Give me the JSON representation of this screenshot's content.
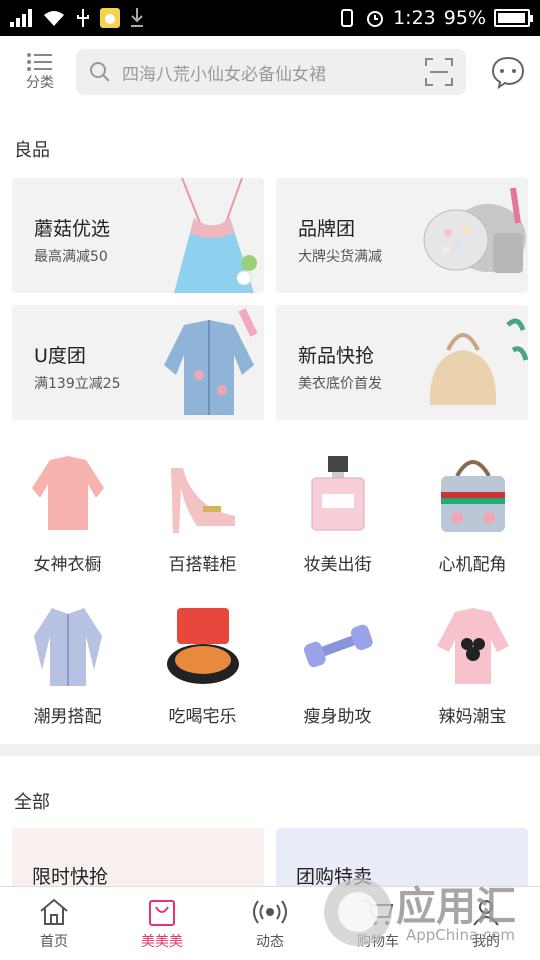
{
  "status_bar": {
    "time": "1:23",
    "battery": "95%",
    "battery_level": 0.95
  },
  "header": {
    "category_label": "分类",
    "search_placeholder": "四海八荒小仙女必备仙女裙"
  },
  "section_good": {
    "title": "良品"
  },
  "promo_cards": [
    {
      "title": "蘑菇优选",
      "subtitle": "最高满减50",
      "icon": "lace-dress-icon"
    },
    {
      "title": "品牌团",
      "subtitle": "大牌尖货满减",
      "icon": "makeup-pearls-icon"
    },
    {
      "title": "U度团",
      "subtitle": "满139立减25",
      "icon": "denim-jacket-icon"
    },
    {
      "title": "新品快抢",
      "subtitle": "美衣底价首发",
      "icon": "handbag-icon"
    }
  ],
  "categories": [
    {
      "label": "女神衣橱",
      "icon": "pink-sweater-icon"
    },
    {
      "label": "百搭鞋柜",
      "icon": "heel-shoe-icon"
    },
    {
      "label": "妆美出街",
      "icon": "perfume-icon"
    },
    {
      "label": "心机配角",
      "icon": "bag-icon"
    },
    {
      "label": "潮男搭配",
      "icon": "shirt-icon"
    },
    {
      "label": "吃喝宅乐",
      "icon": "snack-icon"
    },
    {
      "label": "瘦身助攻",
      "icon": "dumbbell-icon"
    },
    {
      "label": "辣妈潮宝",
      "icon": "kids-sweater-icon"
    }
  ],
  "section_all": {
    "title": "全部"
  },
  "bottom_cards": [
    {
      "title": "限时快抢",
      "bg": "#f8f0ef"
    },
    {
      "title": "团购特卖",
      "bg": "#e9ecf6"
    }
  ],
  "tabs": [
    {
      "label": "首页",
      "icon": "home-icon",
      "active": false
    },
    {
      "label": "美美美",
      "icon": "shopping-bag-icon",
      "active": true
    },
    {
      "label": "动态",
      "icon": "broadcast-icon",
      "active": false
    },
    {
      "label": "购物车",
      "icon": "cart-icon",
      "active": false
    },
    {
      "label": "我的",
      "icon": "profile-icon",
      "active": false
    }
  ],
  "watermark": {
    "brand": "应用汇",
    "site": "AppChina.com"
  },
  "colors": {
    "accent": "#e8336f",
    "card_bg": "#f2f2f2"
  }
}
